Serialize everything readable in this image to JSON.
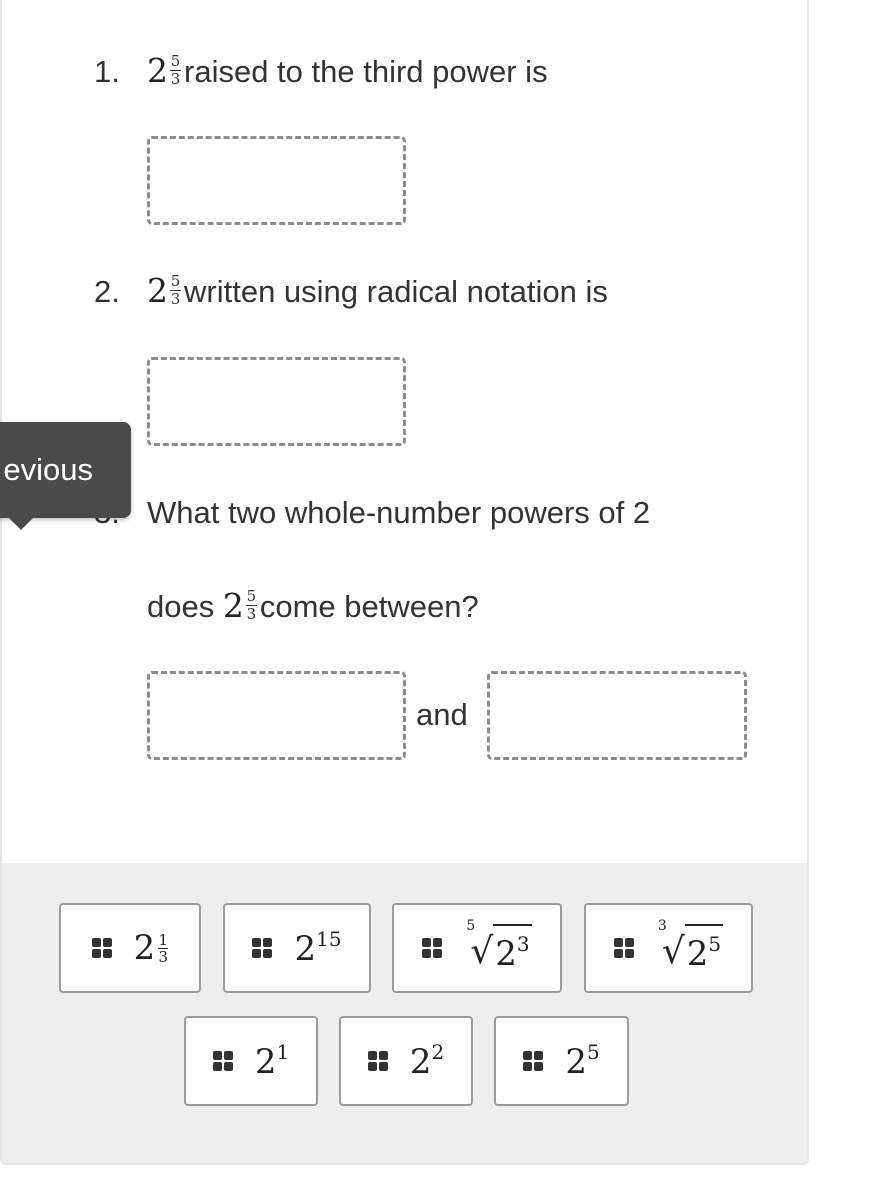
{
  "questions": [
    {
      "number": "1.",
      "base": "2",
      "exponent_numerator": "5",
      "exponent_denominator": "3",
      "text": "raised to the third power is"
    },
    {
      "number": "2.",
      "base": "2",
      "exponent_numerator": "5",
      "exponent_denominator": "3",
      "text": "written using radical notation is"
    },
    {
      "number": "3.",
      "line1": "What two whole-number powers of 2",
      "prefix": "does ",
      "base": "2",
      "exponent_numerator": "5",
      "exponent_denominator": "3",
      "text": "come between?",
      "connector": "and"
    }
  ],
  "tooltip": {
    "text": "Previous",
    "visible_text": "evious"
  },
  "tiles": [
    {
      "kind": "frac-power",
      "base": "2",
      "numerator": "1",
      "denominator": "3"
    },
    {
      "kind": "power",
      "base": "2",
      "exponent": "15"
    },
    {
      "kind": "radical",
      "index": "5",
      "base": "2",
      "exponent": "3"
    },
    {
      "kind": "radical",
      "index": "3",
      "base": "2",
      "exponent": "5"
    },
    {
      "kind": "power",
      "base": "2",
      "exponent": "1"
    },
    {
      "kind": "power",
      "base": "2",
      "exponent": "2"
    },
    {
      "kind": "power",
      "base": "2",
      "exponent": "5"
    }
  ],
  "colors": {
    "tray_background": "#eeeeee",
    "tooltip_background": "#4a4a4a",
    "dropzone_border": "#8c8c8c",
    "tile_border": "#9b9b9b"
  }
}
